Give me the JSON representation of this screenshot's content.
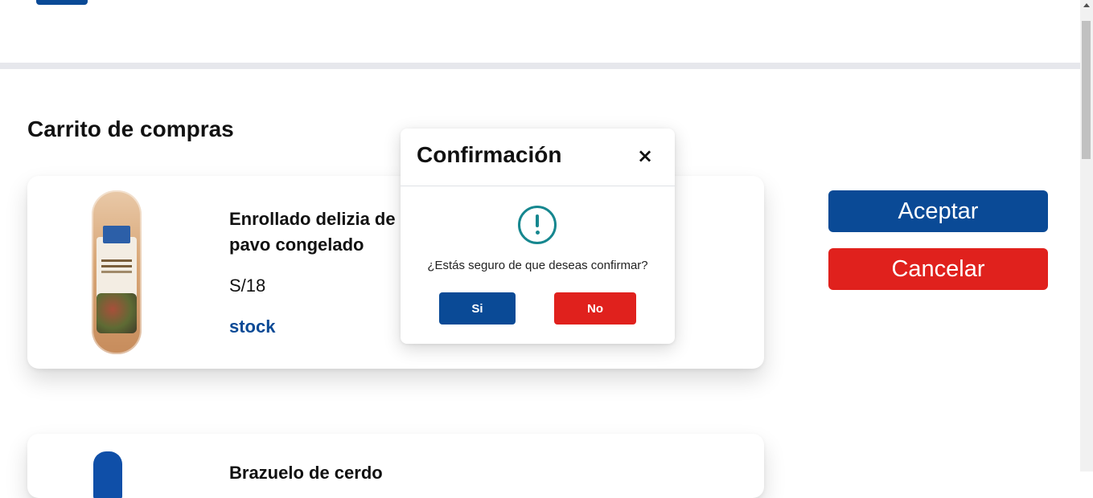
{
  "cart": {
    "title": "Carrito de compras",
    "items": [
      {
        "name": "Enrollado delizia de pavo congelado",
        "price": "S/18",
        "stock": "stock",
        "image_icon": "product-image"
      },
      {
        "name": "Brazuelo de cerdo",
        "image_icon": "product-image"
      }
    ]
  },
  "actions": {
    "accept_label": "Aceptar",
    "cancel_label": "Cancelar"
  },
  "modal": {
    "title": "Confirmación",
    "close_symbol": "×",
    "message": "¿Estás seguro de que deseas confirmar?",
    "yes_label": "Si",
    "no_label": "No",
    "icon": "exclamation-circle-icon"
  },
  "colors": {
    "primary": "#0a4a96",
    "danger": "#e0211d",
    "info_icon": "#16878f"
  }
}
